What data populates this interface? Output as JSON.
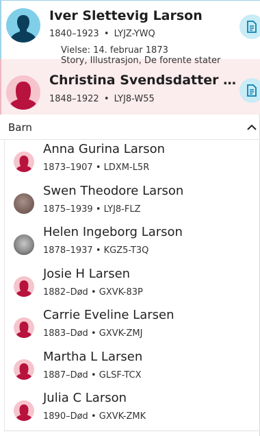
{
  "father": {
    "name": "Iver Slettevig Larson",
    "lifespan": "1840–1923",
    "separator": "•",
    "pid": "LYJZ-YWQ",
    "marriage": "Vielse: 14. februar 1873",
    "sources": "Story, Illustrasjon, De forente stater",
    "avatar_icon": "male-silhouette-icon",
    "action_icon": "record-icon"
  },
  "mother": {
    "name": "Christina Svendsdatter Tho...",
    "lifespan": "1848–1922",
    "separator": "•",
    "pid": "LYJ8-W55",
    "avatar_icon": "female-silhouette-icon",
    "action_icon": "record-icon"
  },
  "children_section": {
    "label": "Barn",
    "toggle_icon": "chevron-up-icon"
  },
  "children": [
    {
      "name": "Anna Gurina Larson",
      "lifespan": "1873–1907",
      "pid": "LDXM-L5R",
      "avatar": "female"
    },
    {
      "name": "Swen Theodore Larson",
      "lifespan": "1875–1939",
      "pid": "LYJ8-FLZ",
      "avatar": "photo1"
    },
    {
      "name": "Helen Ingeborg Larson",
      "lifespan": "1878–1937",
      "pid": "KGZ5-T3Q",
      "avatar": "photo2"
    },
    {
      "name": "Josie H Larsen",
      "lifespan": "1882–Død",
      "pid": "GXVK-83P",
      "avatar": "female"
    },
    {
      "name": "Carrie Eveline Larsen",
      "lifespan": "1883–Død",
      "pid": "GXVK-ZMJ",
      "avatar": "female"
    },
    {
      "name": "Martha L Larsen",
      "lifespan": "1887–Død",
      "pid": "GLSF-TCX",
      "avatar": "female"
    },
    {
      "name": "Julia C Larson",
      "lifespan": "1890–Død",
      "pid": "GXVK-ZMK",
      "avatar": "female"
    }
  ],
  "colors": {
    "male_accent": "#7fcfe9",
    "female_accent": "#f6c4cc",
    "female_icon": "#b8123e",
    "male_icon": "#0b3e5a",
    "action_bg": "#c9ecf6",
    "action_icon": "#0a7fae"
  }
}
